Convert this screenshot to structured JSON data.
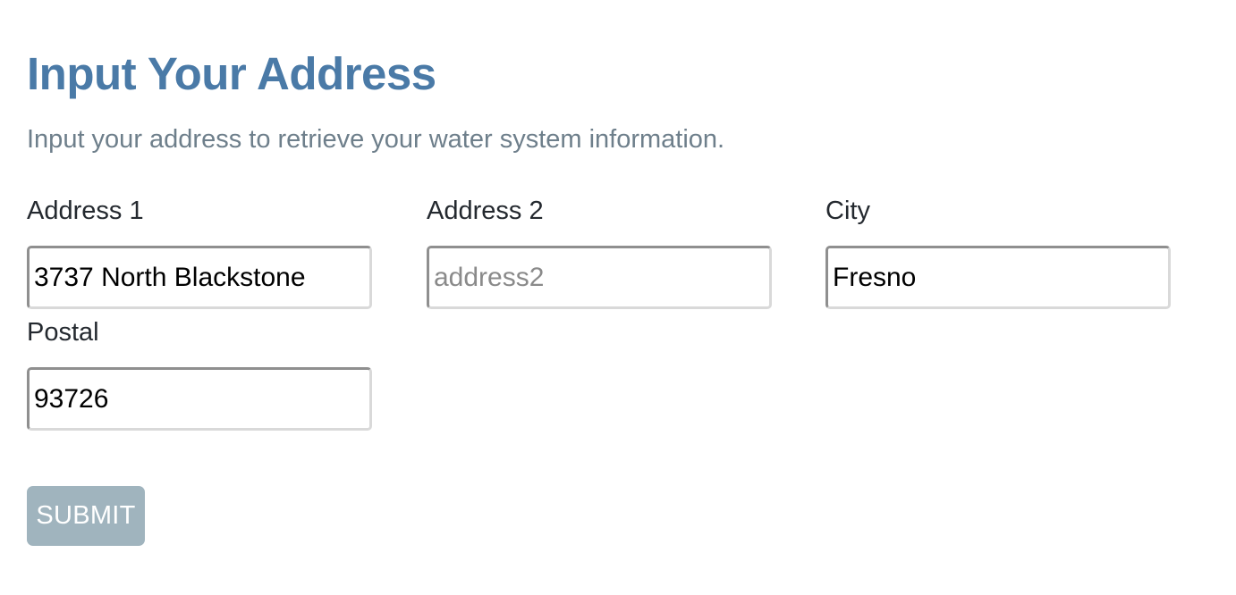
{
  "header": {
    "title": "Input Your Address",
    "subtitle": "Input your address to retrieve your water system information."
  },
  "form": {
    "address1": {
      "label": "Address 1",
      "value": "3737 North Blackstone",
      "placeholder": ""
    },
    "address2": {
      "label": "Address 2",
      "value": "",
      "placeholder": "address2"
    },
    "city": {
      "label": "City",
      "value": "Fresno",
      "placeholder": ""
    },
    "postal": {
      "label": "Postal",
      "value": "93726",
      "placeholder": ""
    },
    "submit_label": "SUBMIT",
    "submit_disabled": true
  },
  "colors": {
    "title": "#4a7aa7",
    "subtitle": "#6e7f8b",
    "submit_bg": "#a0b4be"
  }
}
